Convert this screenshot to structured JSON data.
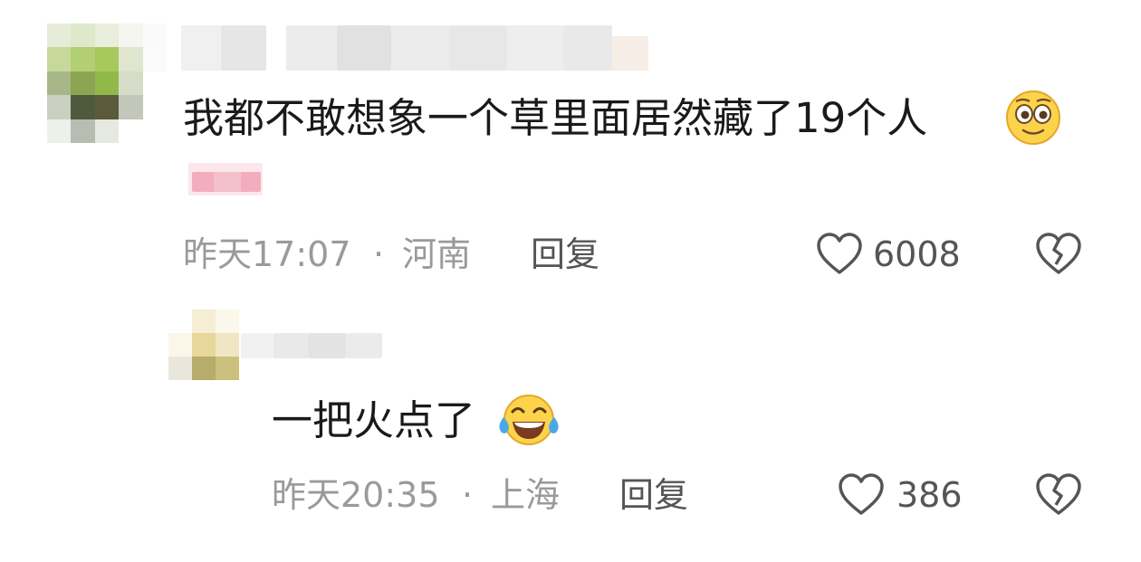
{
  "comments": [
    {
      "text": "我都不敢想象一个草里面居然藏了19个人",
      "emoji": "smirk-face-emoji",
      "time": "昨天17:07",
      "separator": "·",
      "location": "河南",
      "reply_label": "回复",
      "likes": "6008"
    },
    {
      "text": "一把火点了",
      "emoji": "tears-of-joy-emoji",
      "time": "昨天20:35",
      "separator": "·",
      "location": "上海",
      "reply_label": "回复",
      "likes": "386"
    }
  ],
  "colors": {
    "text": "#1a1a1a",
    "meta": "#9a9a9a",
    "action": "#555555",
    "badge_pink": "#f0a8b8"
  },
  "icons": [
    "heart-outline-icon",
    "broken-heart-icon"
  ]
}
